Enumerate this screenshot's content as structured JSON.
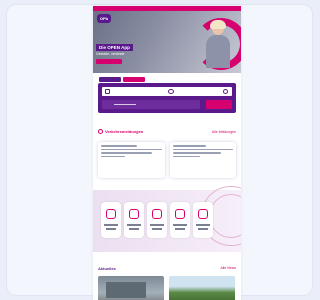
{
  "page": {
    "brand_logo": "OPb",
    "hero": {
      "title": "Die OPEN App",
      "subtitle": "Gestalte, verbinde"
    },
    "traffic_section": {
      "title": "Verkehrsmeldungen",
      "link": "Alle Meldungen"
    },
    "news_section": {
      "title": "Aktuelles",
      "link": "Alle News"
    }
  },
  "colors": {
    "brand_purple": "#5b1a8c",
    "brand_pink": "#d6006e",
    "background": "#f3f6fc"
  }
}
